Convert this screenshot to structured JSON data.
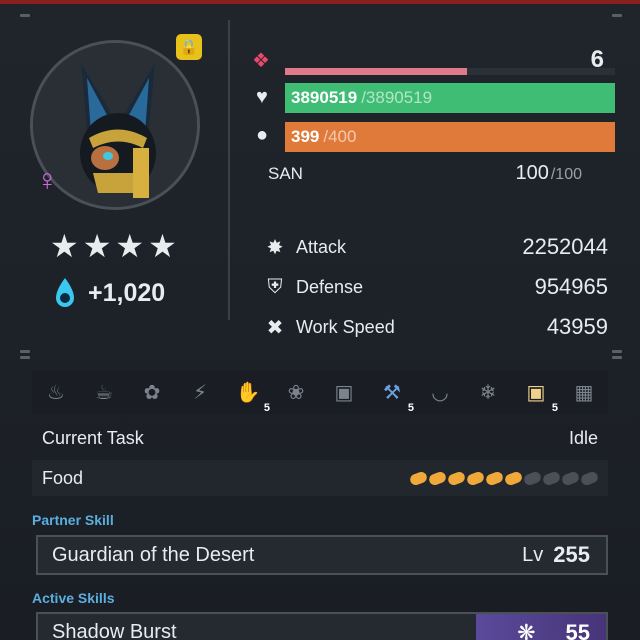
{
  "level": {
    "value": "6",
    "exp_fraction": 0.55
  },
  "hp": {
    "current": "3890519",
    "max": "/3890519",
    "fraction": 1.0
  },
  "stamina": {
    "current": "399",
    "max": "/400",
    "fraction": 0.9975
  },
  "san": {
    "label": "SAN",
    "current": "100",
    "max": "/100"
  },
  "stats": [
    {
      "icon": "attack-icon",
      "label": "Attack",
      "value": "2252044"
    },
    {
      "icon": "defense-shield-icon",
      "label": "Defense",
      "value": "954965"
    },
    {
      "icon": "work-speed-icon",
      "label": "Work Speed",
      "value": "43959"
    }
  ],
  "rank_stars": 4,
  "souls": "+1,020",
  "work_suitability": [
    {
      "icon": "kindling-icon",
      "level": ""
    },
    {
      "icon": "watering-icon",
      "level": ""
    },
    {
      "icon": "planting-icon",
      "level": ""
    },
    {
      "icon": "electricity-icon",
      "level": ""
    },
    {
      "icon": "handiwork-icon",
      "level": "5"
    },
    {
      "icon": "gathering-icon",
      "level": ""
    },
    {
      "icon": "lumbering-icon",
      "level": ""
    },
    {
      "icon": "mining-icon",
      "level": "5"
    },
    {
      "icon": "medicine-icon",
      "level": ""
    },
    {
      "icon": "cooling-icon",
      "level": ""
    },
    {
      "icon": "transporting-icon",
      "level": "5"
    },
    {
      "icon": "farming-icon",
      "level": ""
    }
  ],
  "current_task": {
    "label": "Current Task",
    "value": "Idle"
  },
  "food": {
    "label": "Food",
    "filled": 6,
    "total": 10
  },
  "partner_skill": {
    "section": "Partner Skill",
    "name": "Guardian of the Desert",
    "lv_label": "Lv",
    "lv_value": "255"
  },
  "active_skills": {
    "section": "Active Skills",
    "items": [
      {
        "name": "Shadow Burst",
        "element_icon": "dark-element-icon",
        "power": "55"
      }
    ]
  },
  "colors": {
    "hp": "#3fbd74",
    "stamina": "#e07a3a",
    "exp": "#e07a8a",
    "section": "#5aaee0",
    "dark_element": "#5a4a9a"
  }
}
